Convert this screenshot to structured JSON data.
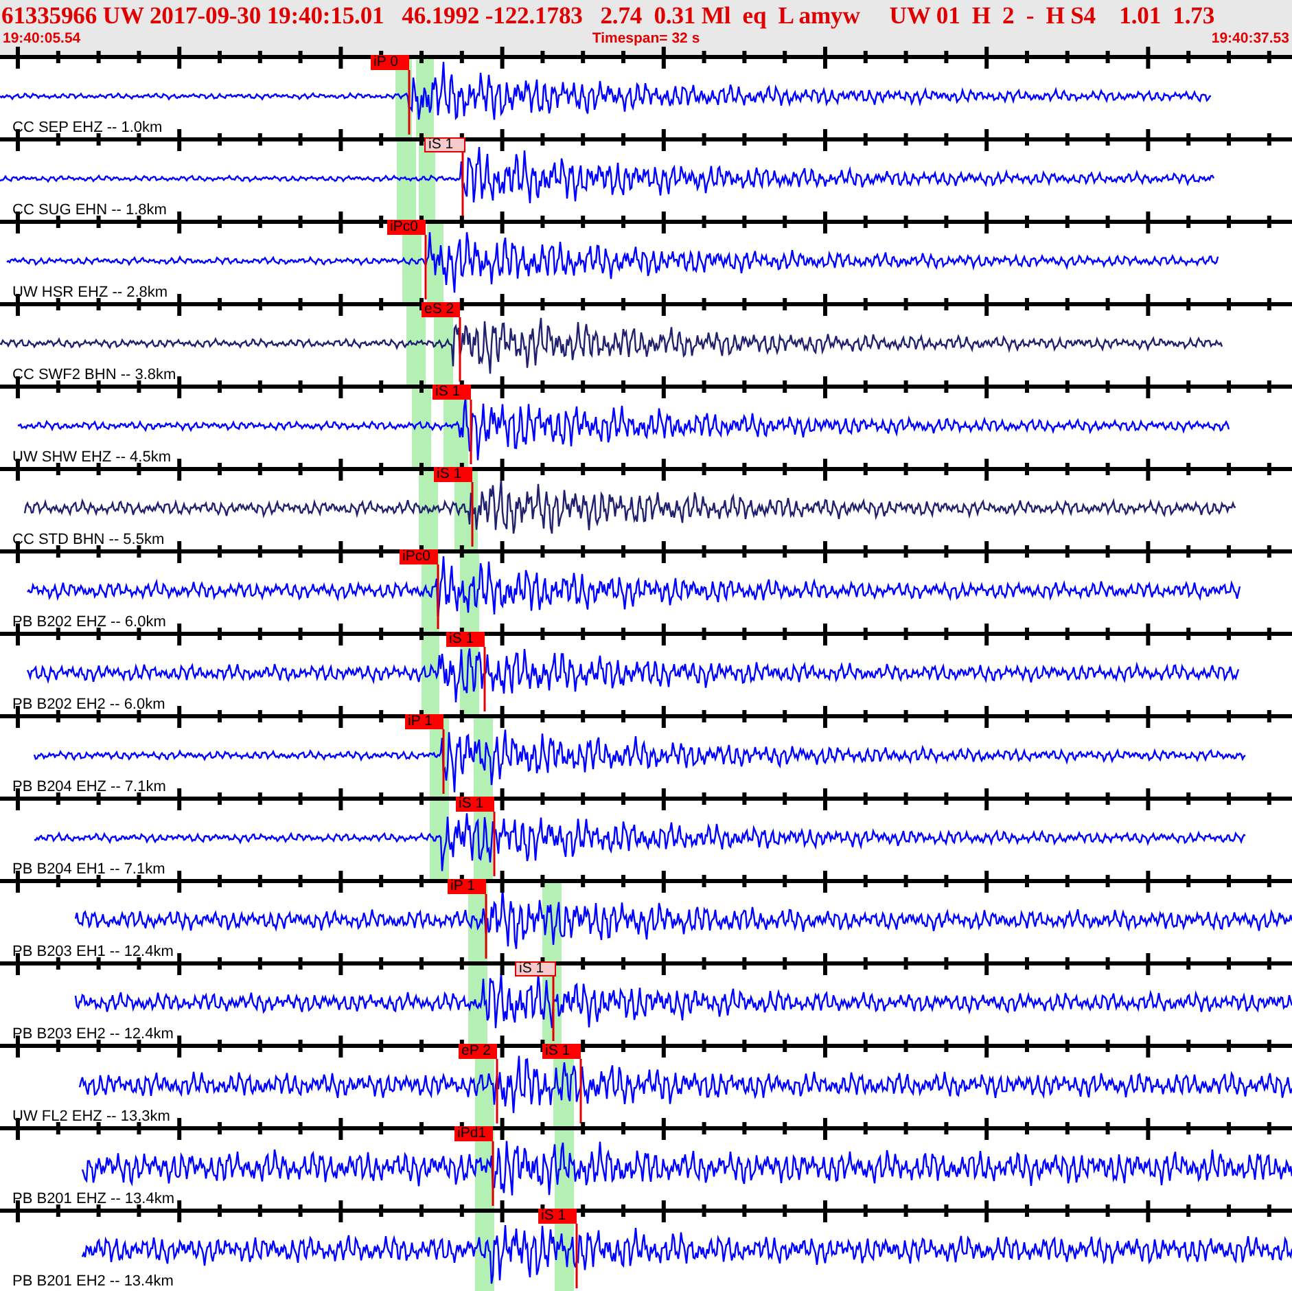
{
  "header": {
    "event_line": "61335966 UW 2017-09-30 19:40:15.01   46.1992 -122.1783   2.74  0.31 Ml  eq  L amyw     UW 01  H  2  -  H S4    1.01  1.73",
    "start_time": "19:40:05.54",
    "timespan": "Timespan=  32 s",
    "end_time": "19:40:37.53"
  },
  "traces": [
    {
      "label": "CC SEP EHZ -- 1.0km",
      "color": "#0000ff",
      "picks": [
        {
          "label": "iP 0",
          "faded": false
        }
      ]
    },
    {
      "label": "CC SUG EHN -- 1.8km",
      "color": "#0000ff",
      "picks": [
        {
          "label": "iS 1",
          "faded": true
        }
      ]
    },
    {
      "label": "UW HSR EHZ -- 2.8km",
      "color": "#0000ff",
      "picks": [
        {
          "label": "iPc0",
          "faded": false
        }
      ]
    },
    {
      "label": "CC SWF2 BHN -- 3.8km",
      "color": "#20206e",
      "picks": [
        {
          "label": "eS 2",
          "faded": false
        }
      ]
    },
    {
      "label": "UW SHW EHZ -- 4.5km",
      "color": "#0000ff",
      "picks": [
        {
          "label": "iS 1",
          "faded": false
        }
      ]
    },
    {
      "label": "CC STD BHN -- 5.5km",
      "color": "#20206e",
      "picks": [
        {
          "label": "iS 1",
          "faded": false
        }
      ]
    },
    {
      "label": "PB B202 EHZ -- 6.0km",
      "color": "#0000ff",
      "picks": [
        {
          "label": "iPc0",
          "faded": false
        }
      ]
    },
    {
      "label": "PB B202 EH2 -- 6.0km",
      "color": "#0000ff",
      "picks": [
        {
          "label": "iS 1",
          "faded": false
        }
      ]
    },
    {
      "label": "PB B204 EHZ -- 7.1km",
      "color": "#0000ff",
      "picks": [
        {
          "label": "iP 1",
          "faded": false
        }
      ]
    },
    {
      "label": "PB B204 EH1 -- 7.1km",
      "color": "#0000ff",
      "picks": [
        {
          "label": "iS 1",
          "faded": false
        }
      ]
    },
    {
      "label": "PB B203 EH1 -- 12.4km",
      "color": "#0000ff",
      "picks": [
        {
          "label": "iP 1",
          "faded": false
        }
      ]
    },
    {
      "label": "PB B203 EH2 -- 12.4km",
      "color": "#0000ff",
      "picks": [
        {
          "label": "iS 1",
          "faded": true
        }
      ]
    },
    {
      "label": "UW FL2 EHZ -- 13.3km",
      "color": "#0000ff",
      "picks": [
        {
          "label": "eP 2",
          "faded": false
        },
        {
          "label": "iS 1",
          "faded": false
        }
      ]
    },
    {
      "label": "PB B201 EHZ -- 13.4km",
      "color": "#0000ff",
      "picks": [
        {
          "label": "iPd1",
          "faded": false
        }
      ]
    },
    {
      "label": "PB B201 EH2 -- 13.4km",
      "color": "#0000ff",
      "picks": [
        {
          "label": "iS 1",
          "faded": false
        }
      ]
    }
  ]
}
